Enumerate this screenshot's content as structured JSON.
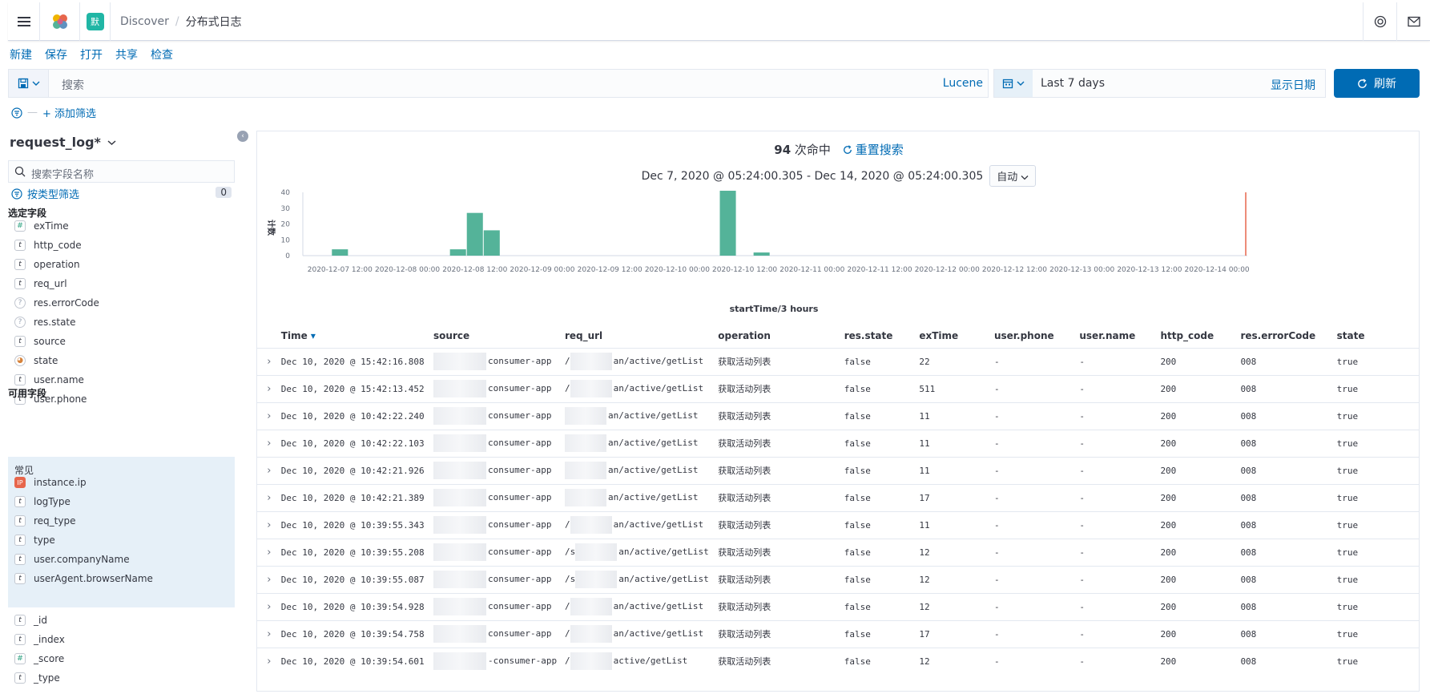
{
  "header": {
    "space_initial": "默",
    "breadcrumb_app": "Discover",
    "breadcrumb_sep": "/",
    "breadcrumb_page": "分布式日志"
  },
  "menu": {
    "new": "新建",
    "save": "保存",
    "open": "打开",
    "share": "共享",
    "inspect": "检查"
  },
  "query": {
    "placeholder": "搜索",
    "language": "Lucene"
  },
  "time": {
    "range_label": "Last 7 days",
    "show_dates": "显示日期",
    "refresh": "刷新"
  },
  "filters": {
    "add": "+ 添加筛选"
  },
  "sidebar": {
    "index_pattern": "request_log*",
    "field_search_placeholder": "搜索字段名称",
    "type_filter": "按类型筛选",
    "type_filter_count": "0",
    "selected_title": "选定字段",
    "selected_fields": [
      {
        "type": "#",
        "name": "exTime"
      },
      {
        "type": "t",
        "name": "http_code"
      },
      {
        "type": "t",
        "name": "operation"
      },
      {
        "type": "t",
        "name": "req_url"
      },
      {
        "type": "?",
        "name": "res.errorCode"
      },
      {
        "type": "?",
        "name": "res.state"
      },
      {
        "type": "t",
        "name": "source"
      },
      {
        "type": "geo",
        "name": "state"
      },
      {
        "type": "t",
        "name": "user.name"
      },
      {
        "type": "t",
        "name": "user.phone"
      }
    ],
    "available_title": "可用字段",
    "common_title": "常见",
    "common_fields": [
      {
        "type": "IP",
        "name": "instance.ip"
      },
      {
        "type": "t",
        "name": "logType"
      },
      {
        "type": "t",
        "name": "req_type"
      },
      {
        "type": "t",
        "name": "type"
      },
      {
        "type": "t",
        "name": "user.companyName"
      },
      {
        "type": "t",
        "name": "userAgent.browserName"
      }
    ],
    "other_fields": [
      {
        "type": "t",
        "name": "_id"
      },
      {
        "type": "t",
        "name": "_index"
      },
      {
        "type": "#",
        "name": "_score"
      },
      {
        "type": "t",
        "name": "_type"
      }
    ]
  },
  "summary": {
    "hit_count": "94",
    "hit_suffix": "次命中",
    "reset_search": "重置搜索",
    "date_range": "Dec 7, 2020 @ 05:24:00.305 - Dec 14, 2020 @ 05:24:00.305",
    "interval": "自动"
  },
  "chart_data": {
    "type": "bar",
    "xlabel": "startTime/3 hours",
    "ylabel": "计数",
    "ylim": [
      0,
      40
    ],
    "yticks": [
      0,
      10,
      20,
      30,
      40
    ],
    "x_ticks": [
      "2020-12-07 12:00",
      "2020-12-08 00:00",
      "2020-12-08 12:00",
      "2020-12-09 00:00",
      "2020-12-09 12:00",
      "2020-12-10 00:00",
      "2020-12-10 12:00",
      "2020-12-11 00:00",
      "2020-12-11 12:00",
      "2020-12-12 00:00",
      "2020-12-12 12:00",
      "2020-12-13 00:00",
      "2020-12-13 12:00",
      "2020-12-14 00:00"
    ],
    "bars": [
      {
        "x": "2020-12-07 12:00",
        "y": 4
      },
      {
        "x": "2020-12-08 09:00",
        "y": 4
      },
      {
        "x": "2020-12-08 12:00",
        "y": 27
      },
      {
        "x": "2020-12-08 15:00",
        "y": 16
      },
      {
        "x": "2020-12-10 09:00",
        "y": 41
      },
      {
        "x": "2020-12-10 15:00",
        "y": 2
      }
    ],
    "bar_color": "#54b399",
    "now_marker_color": "#e7664c",
    "grid": false
  },
  "table": {
    "columns": [
      "Time",
      "source",
      "req_url",
      "operation",
      "res.state",
      "exTime",
      "user.phone",
      "user.name",
      "http_code",
      "res.errorCode",
      "state"
    ],
    "rows": [
      [
        "Dec 10, 2020 @ 15:42:16.808",
        "consumer-app",
        "/",
        "an/active/getList",
        "获取活动列表",
        "false",
        "22",
        "-",
        "-",
        "200",
        "008",
        "true"
      ],
      [
        "Dec 10, 2020 @ 15:42:13.452",
        "consumer-app",
        "/",
        "an/active/getList",
        "获取活动列表",
        "false",
        "511",
        "-",
        "-",
        "200",
        "008",
        "true"
      ],
      [
        "Dec 10, 2020 @ 10:42:22.240",
        "consumer-app",
        "",
        "an/active/getList",
        "获取活动列表",
        "false",
        "11",
        "-",
        "-",
        "200",
        "008",
        "true"
      ],
      [
        "Dec 10, 2020 @ 10:42:22.103",
        "consumer-app",
        "",
        "an/active/getList",
        "获取活动列表",
        "false",
        "11",
        "-",
        "-",
        "200",
        "008",
        "true"
      ],
      [
        "Dec 10, 2020 @ 10:42:21.926",
        "consumer-app",
        "",
        "an/active/getList",
        "获取活动列表",
        "false",
        "11",
        "-",
        "-",
        "200",
        "008",
        "true"
      ],
      [
        "Dec 10, 2020 @ 10:42:21.389",
        "consumer-app",
        "",
        "an/active/getList",
        "获取活动列表",
        "false",
        "17",
        "-",
        "-",
        "200",
        "008",
        "true"
      ],
      [
        "Dec 10, 2020 @ 10:39:55.343",
        "consumer-app",
        "/",
        "an/active/getList",
        "获取活动列表",
        "false",
        "11",
        "-",
        "-",
        "200",
        "008",
        "true"
      ],
      [
        "Dec 10, 2020 @ 10:39:55.208",
        "consumer-app",
        "/s",
        "an/active/getList",
        "获取活动列表",
        "false",
        "12",
        "-",
        "-",
        "200",
        "008",
        "true"
      ],
      [
        "Dec 10, 2020 @ 10:39:55.087",
        "consumer-app",
        "/s",
        "an/active/getList",
        "获取活动列表",
        "false",
        "12",
        "-",
        "-",
        "200",
        "008",
        "true"
      ],
      [
        "Dec 10, 2020 @ 10:39:54.928",
        "consumer-app",
        "/",
        "an/active/getList",
        "获取活动列表",
        "false",
        "12",
        "-",
        "-",
        "200",
        "008",
        "true"
      ],
      [
        "Dec 10, 2020 @ 10:39:54.758",
        "consumer-app",
        "/",
        "an/active/getList",
        "获取活动列表",
        "false",
        "17",
        "-",
        "-",
        "200",
        "008",
        "true"
      ],
      [
        "Dec 10, 2020 @ 10:39:54.601",
        "-consumer-app",
        "/",
        "active/getList",
        "获取活动列表",
        "false",
        "12",
        "-",
        "-",
        "200",
        "008",
        "true"
      ]
    ]
  },
  "icons": {
    "menu": "hamburger-icon",
    "logo": "kibana-logo-icon",
    "help": "help-icon",
    "mail": "mail-icon",
    "calendar": "calendar-icon",
    "refresh": "refresh-icon",
    "filter": "filter-icon",
    "search": "search-icon",
    "expand": "chevron-right-icon"
  }
}
